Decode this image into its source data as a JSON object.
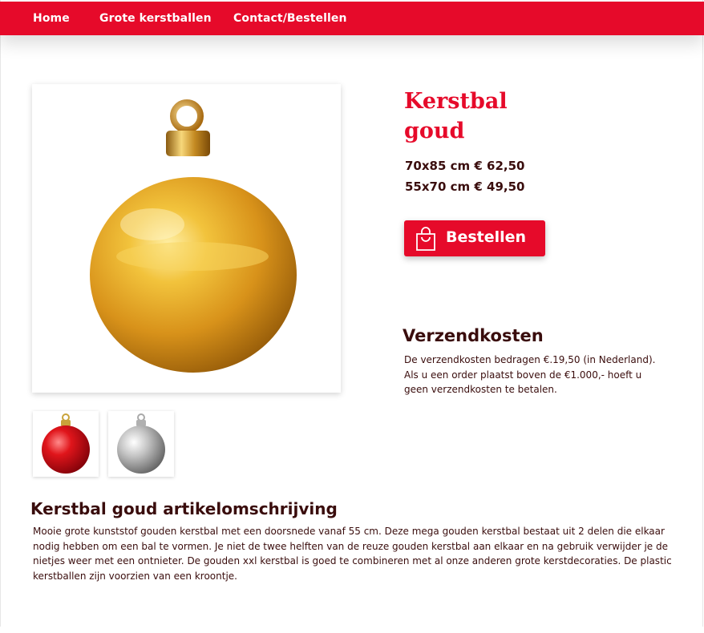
{
  "nav": {
    "items": [
      {
        "label": "Home"
      },
      {
        "label": "Grote kerstballen"
      },
      {
        "label": "Contact/Bestellen"
      }
    ],
    "color": "#e60a2a"
  },
  "product": {
    "title": "Kerstbal goud",
    "prices": [
      "70x85 cm € 62,50",
      "55x70 cm € 49,50"
    ],
    "order_label": "Bestellen",
    "main_image_icon": "gold-christmas-ball",
    "thumbnails": [
      {
        "icon": "red-christmas-ball"
      },
      {
        "icon": "silver-christmas-ball"
      }
    ]
  },
  "shipping": {
    "heading": "Verzendkosten",
    "text": "De verzendkosten bedragen €.19,50 (in Nederland). Als u een order plaatst boven de €1.000,- hoeft u geen verzendkosten te betalen."
  },
  "description": {
    "heading": "Kerstbal goud artikelomschrijving",
    "text": "Mooie grote kunststof gouden kerstbal met een doorsnede vanaf 55 cm. Deze mega gouden kerstbal bestaat uit 2 delen die elkaar nodig hebben om een bal te vormen. Je niet de twee helften van de reuze gouden kerstbal aan elkaar en na gebruik verwijder je de nietjes weer met een ontnieter. De gouden xxl kerstbal is goed te combineren met al onze anderen grote kerstdecoraties. De plastic kerstballen zijn voorzien van een kroontje."
  },
  "colors": {
    "accent": "#e60a2a",
    "text": "#3a0d0d"
  }
}
